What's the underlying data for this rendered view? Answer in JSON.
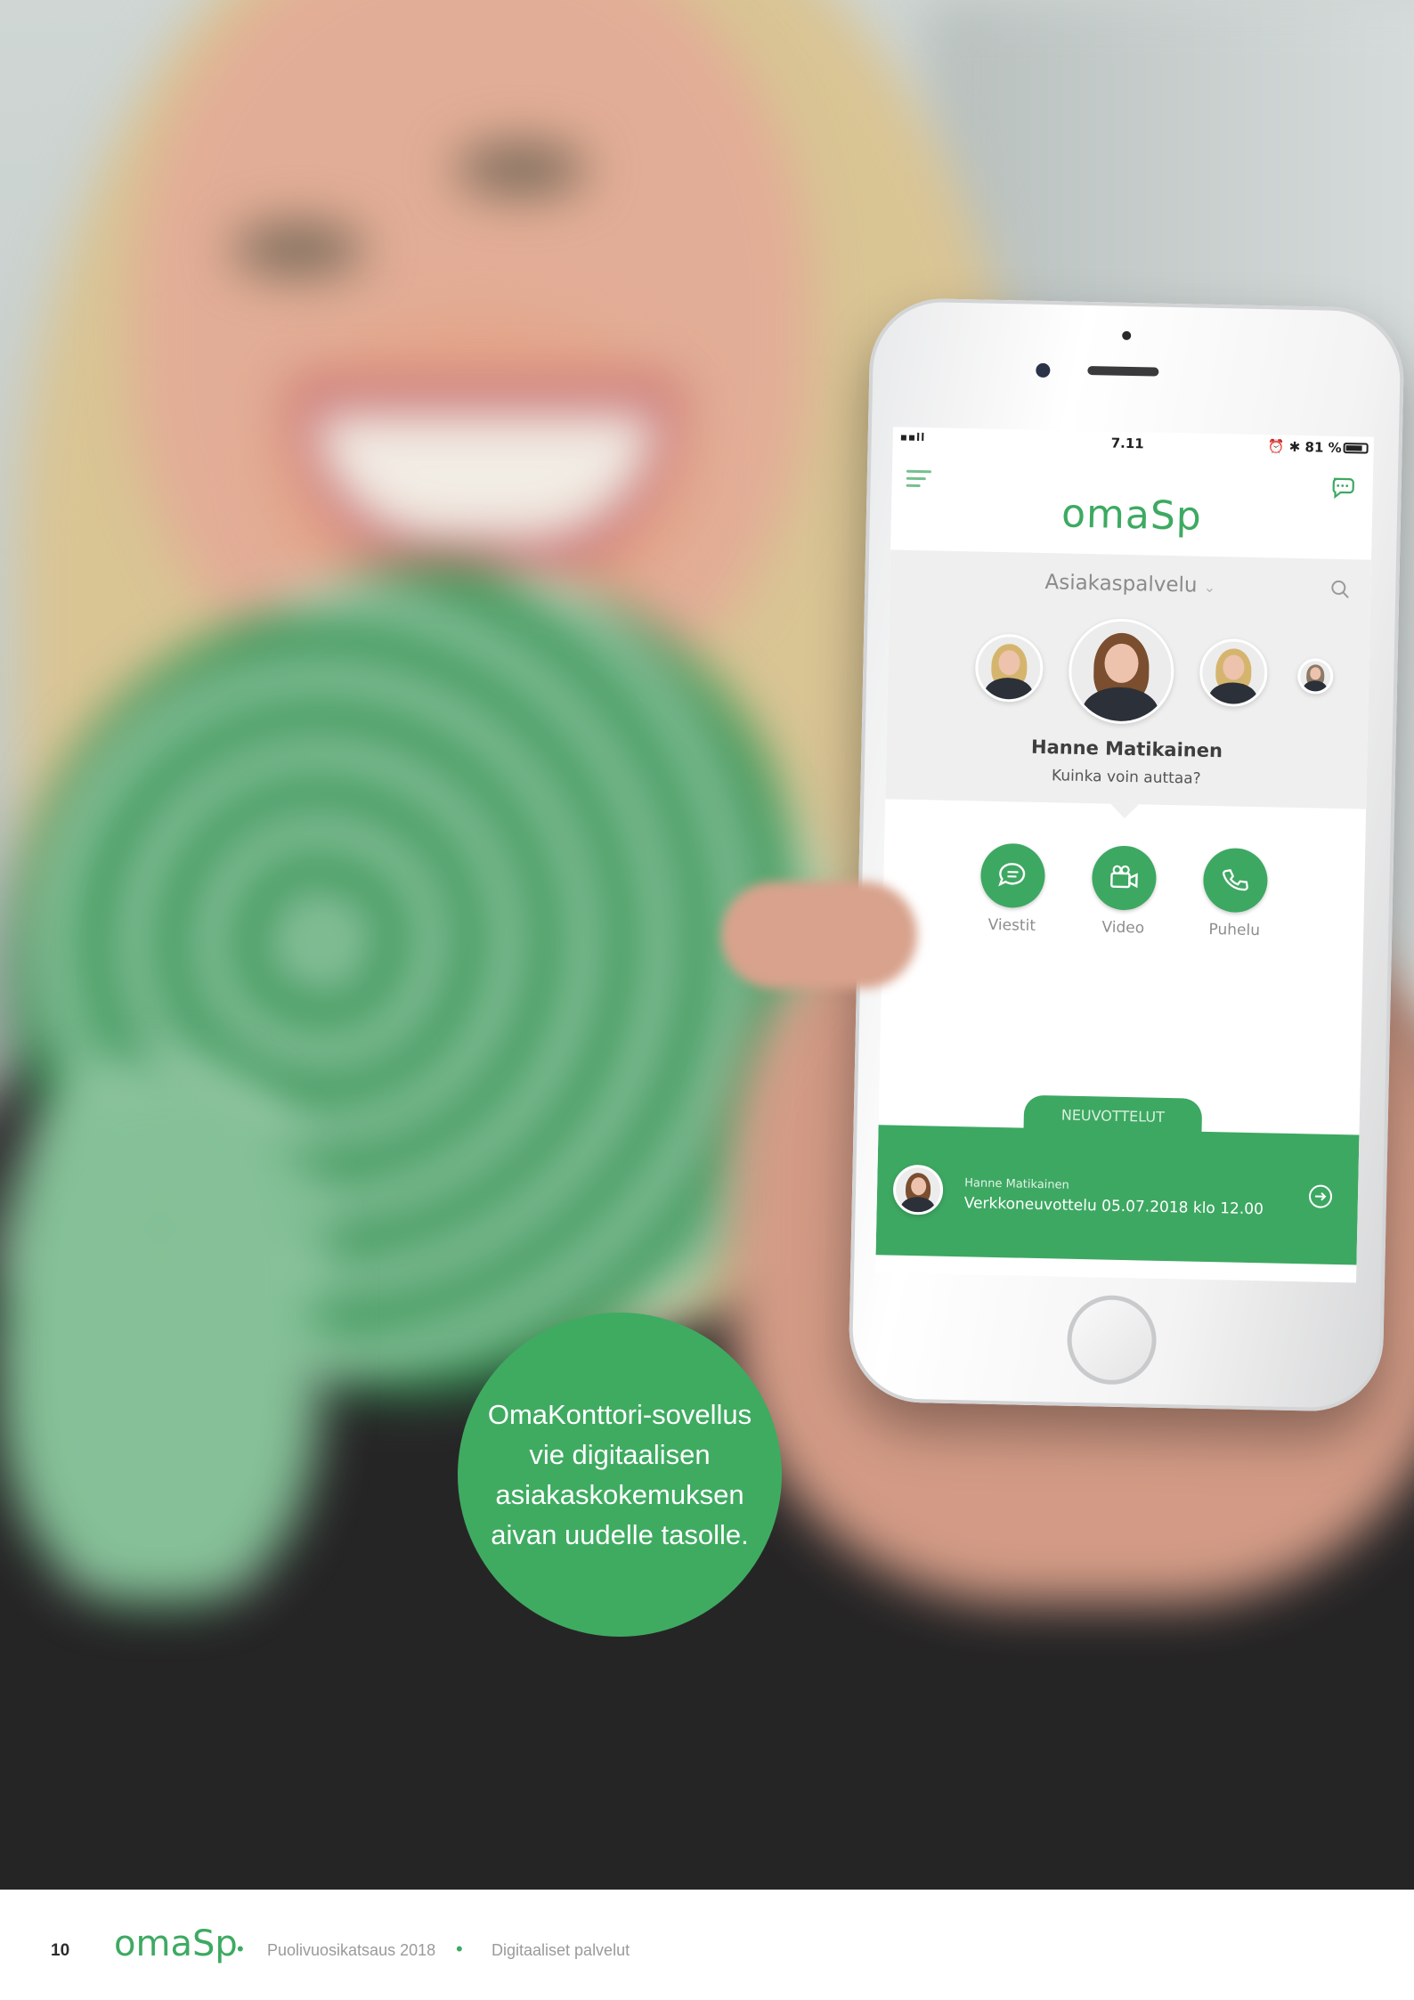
{
  "phone_screen": {
    "status_bar": {
      "signal": "▪▪ll",
      "time": "7.11",
      "battery_text": "⏰ ✱ 81 %",
      "battery_level": 0.81
    },
    "header": {
      "logo": "omaSp"
    },
    "department": {
      "selected": "Asiakaspalvelu",
      "chevron": "⌄"
    },
    "agent": {
      "name": "Hanne Matikainen",
      "greeting": "Kuinka voin auttaa?"
    },
    "actions": [
      {
        "label": "Viestit",
        "icon": "message-icon"
      },
      {
        "label": "Video",
        "icon": "video-camera-icon"
      },
      {
        "label": "Puhelu",
        "icon": "phone-icon"
      }
    ],
    "tab_label": "NEUVOTTELUT",
    "appointment": {
      "name": "Hanne Matikainen",
      "detail": "Verkkoneuvottelu 05.07.2018 klo 12.00"
    }
  },
  "callout": {
    "text": "OmaKonttori-sovellus vie digitaalisen asiakaskokemuksen aivan uudelle tasolle."
  },
  "footer": {
    "page_number": "10",
    "logo": "omaSp",
    "section1": "Puolivuosikatsaus 2018",
    "section2": "Digitaaliset palvelut"
  },
  "colors": {
    "brand_green": "#3da862",
    "panel_gray": "#efefef"
  }
}
